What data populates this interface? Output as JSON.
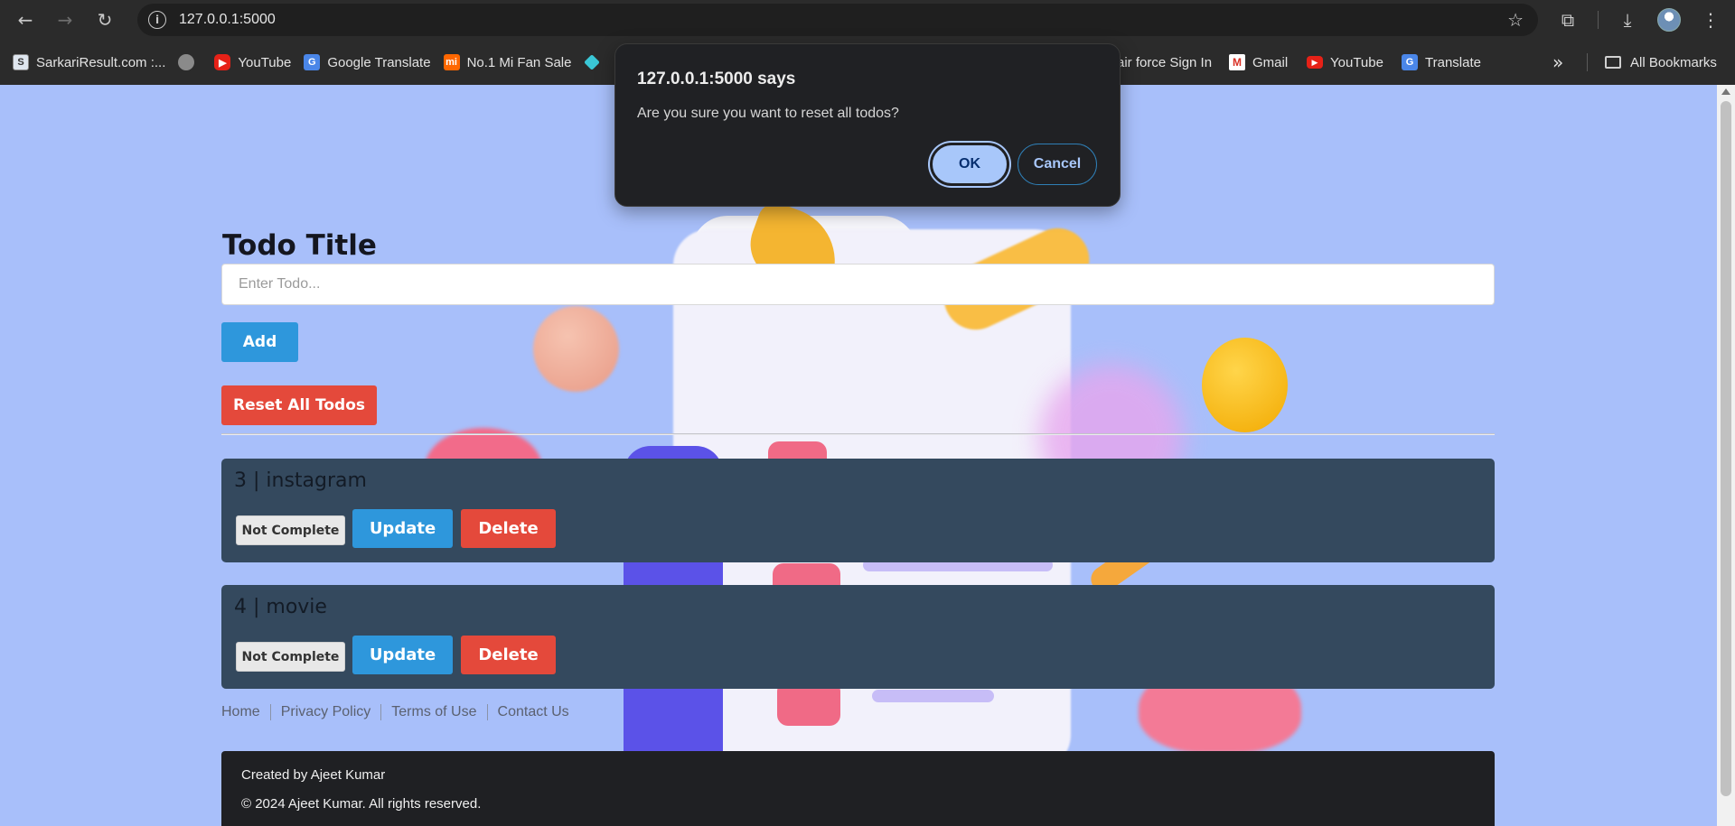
{
  "browser": {
    "url": "127.0.0.1:5000",
    "bookmarks": [
      {
        "label": "SarkariResult.com :...",
        "icon": "sarkari-icon"
      },
      {
        "label": "",
        "icon": "globe-icon"
      },
      {
        "label": "YouTube",
        "icon": "youtube-icon"
      },
      {
        "label": "Google Translate",
        "icon": "google-translate-icon"
      },
      {
        "label": "No.1 Mi Fan Sale",
        "icon": "mi-icon"
      },
      {
        "label": "",
        "icon": "diamond-icon"
      }
    ],
    "bookmarks_right": [
      {
        "label": "air force Sign In"
      },
      {
        "label": "Gmail",
        "icon": "gmail-icon"
      },
      {
        "label": "YouTube",
        "icon": "youtube-icon"
      },
      {
        "label": "Translate",
        "icon": "google-translate-icon"
      }
    ],
    "all_bookmarks": "All Bookmarks",
    "overflow": "»"
  },
  "dialog": {
    "title": "127.0.0.1:5000 says",
    "message": "Are you sure you want to reset all todos?",
    "ok": "OK",
    "cancel": "Cancel"
  },
  "main": {
    "heading": "Todo Title",
    "input_placeholder": "Enter Todo...",
    "add_label": "Add",
    "reset_label": "Reset All Todos"
  },
  "todos": [
    {
      "title": "3 | instagram",
      "status": "Not Complete",
      "update": "Update",
      "delete": "Delete"
    },
    {
      "title": "4 | movie",
      "status": "Not Complete",
      "update": "Update",
      "delete": "Delete"
    }
  ],
  "footer": {
    "links": [
      "Home",
      "Privacy Policy",
      "Terms of Use",
      "Contact Us"
    ],
    "created_by": "Created by Ajeet Kumar",
    "copyright": "© 2024 Ajeet Kumar. All rights reserved."
  },
  "colors": {
    "page_bg": "#a8bffa",
    "primary": "#2e97dc",
    "danger": "#e4493b",
    "card_bg": "#34495e",
    "footer_bg": "#1f2023"
  }
}
